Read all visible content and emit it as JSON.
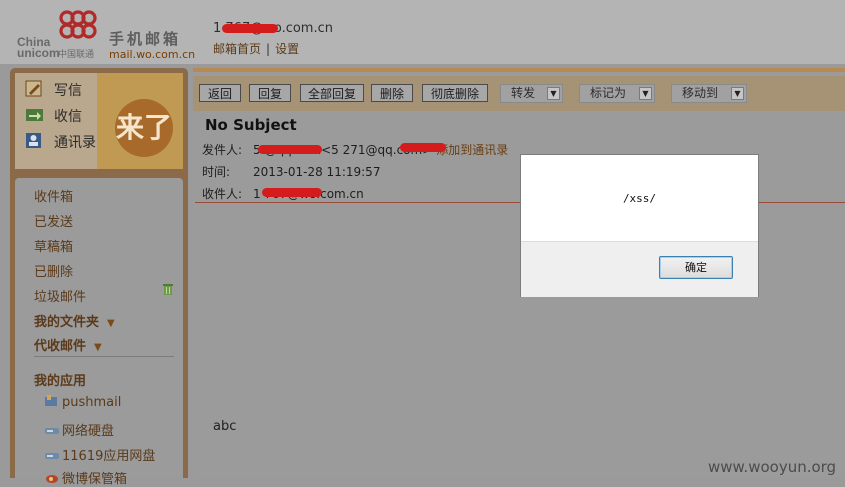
{
  "header": {
    "logo_china": "China",
    "logo_unicom": "unicom",
    "logo_cn": "中国联通",
    "title": "手机邮箱",
    "url": "mail.wo.com.cn",
    "user_email": "1          767@wo.com.cn",
    "links": [
      "邮箱首页",
      "设置"
    ],
    "link_separator": "|"
  },
  "quick_actions": [
    {
      "label": "写信",
      "icon": "pencil-icon"
    },
    {
      "label": "收信",
      "icon": "inbox-arrow-icon"
    },
    {
      "label": "通讯录",
      "icon": "contact-card-icon"
    }
  ],
  "banner_text": "来了",
  "folders": [
    "收件箱",
    "已发送",
    "草稿箱",
    "已删除",
    "垃圾邮件"
  ],
  "sections": [
    "我的文件夹",
    "代收邮件",
    "我的应用"
  ],
  "apps": [
    {
      "label": "pushmail",
      "icon": "pushmail-icon"
    },
    {
      "label": "网络硬盘",
      "icon": "disk-icon"
    },
    {
      "label": "11619应用网盘",
      "icon": "disk-icon"
    },
    {
      "label": "微博保管箱",
      "icon": "weibo-icon"
    }
  ],
  "toolbar": {
    "buttons": [
      "返回",
      "回复",
      "全部回复",
      "删除",
      "彻底删除"
    ],
    "dropdowns": [
      "转发",
      "标记为",
      "移动到"
    ]
  },
  "message": {
    "subject": "No Subject",
    "from_label": "发件人:",
    "from_value": "5          @qq.com<5          271@qq.com>",
    "add_contact": "添加到通讯录",
    "time_label": "时间:",
    "time_value": "2013-01-28 11:19:57",
    "to_label": "收件人:",
    "to_value": "1          767@wo.com.cn",
    "body": "abc"
  },
  "dialog": {
    "message": "/xss/",
    "ok_label": "确定"
  },
  "watermark": "www.wooyun.org",
  "colors": {
    "overlay_gray": "#9a9a9a",
    "accent_brown": "#7a3d00",
    "redaction": "#d41c1c",
    "dialog_button_border": "#3c7fb1"
  }
}
